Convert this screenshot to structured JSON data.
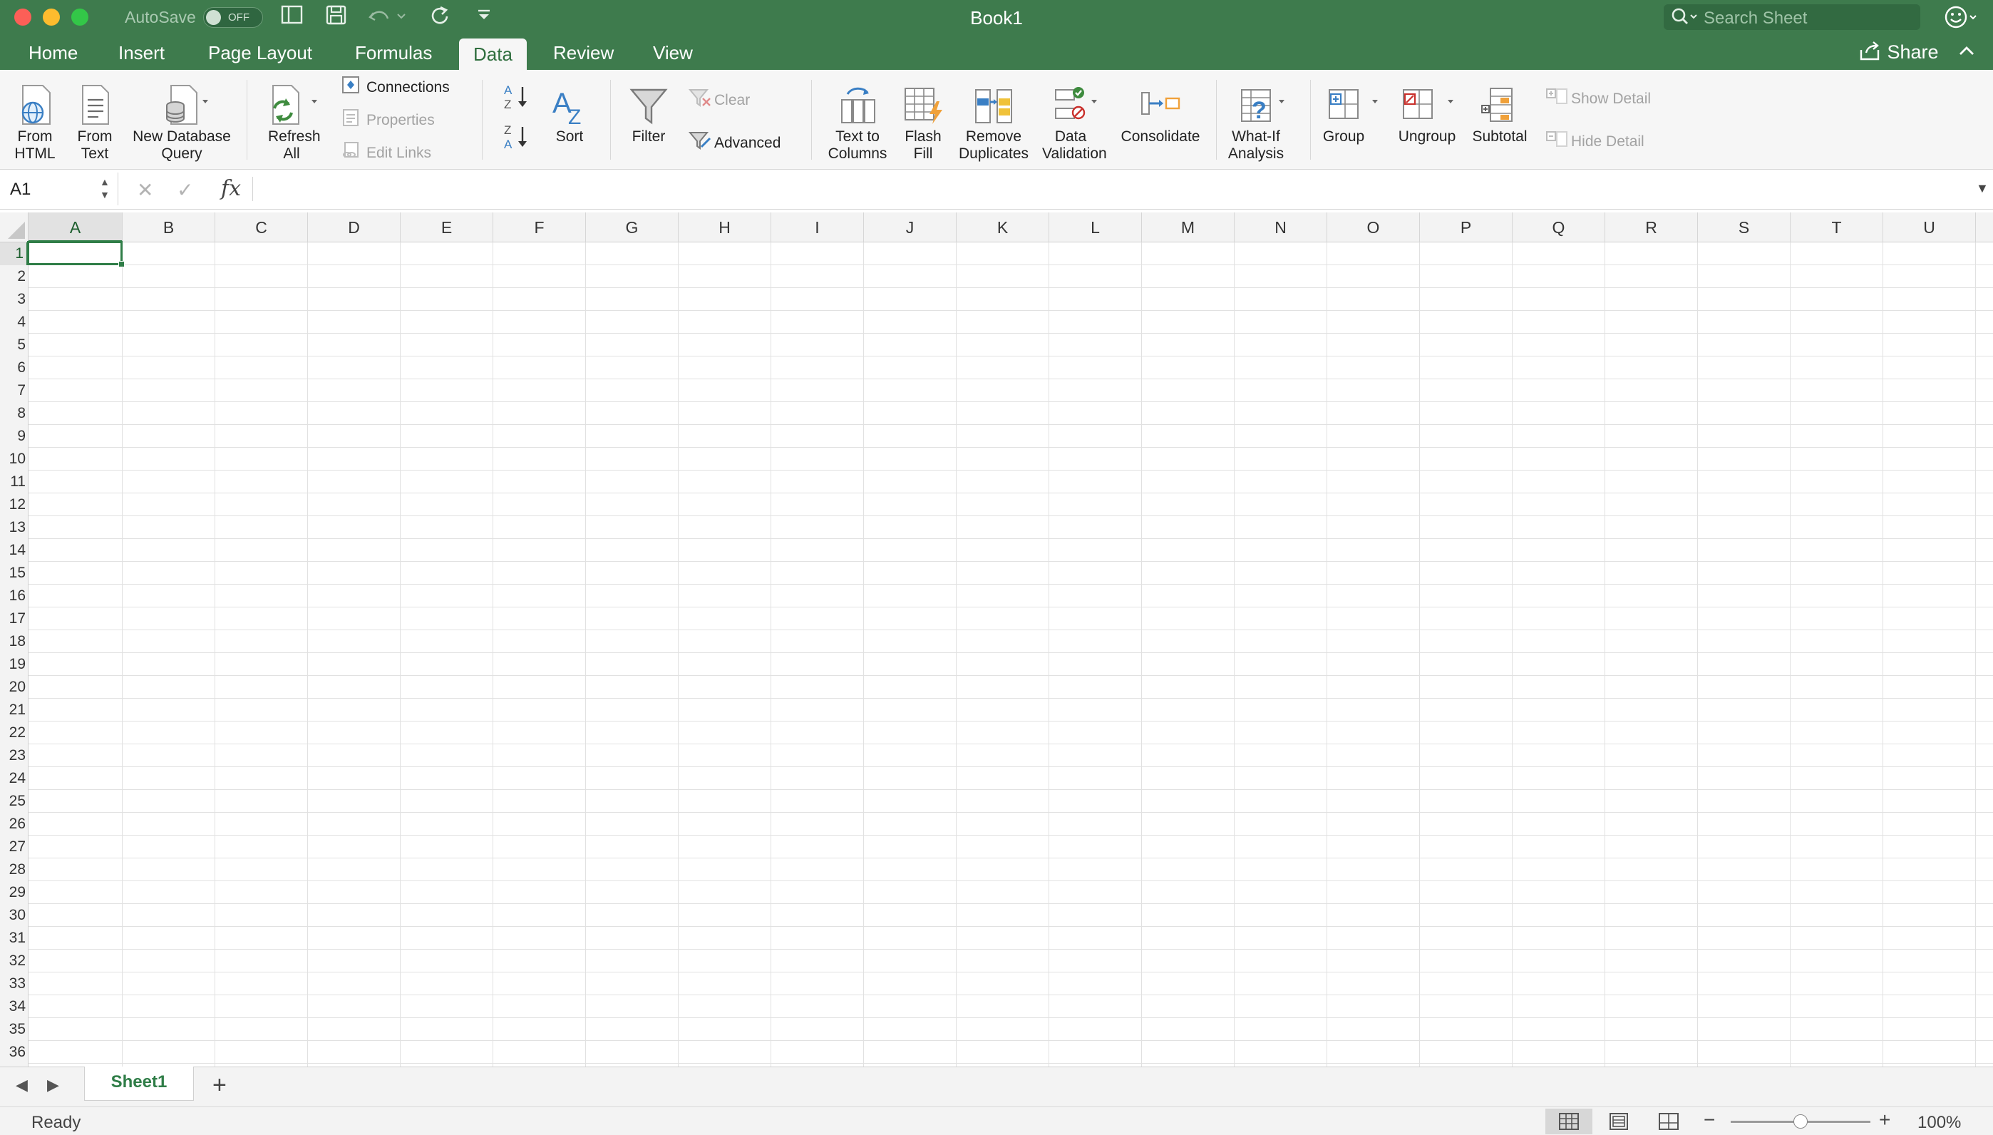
{
  "window": {
    "title": "Book1",
    "autosave_label": "AutoSave",
    "autosave_state": "OFF",
    "search_placeholder": "Search Sheet"
  },
  "tabs": [
    {
      "label": "Home"
    },
    {
      "label": "Insert"
    },
    {
      "label": "Page Layout"
    },
    {
      "label": "Formulas"
    },
    {
      "label": "Data",
      "active": true
    },
    {
      "label": "Review"
    },
    {
      "label": "View"
    }
  ],
  "share_label": "Share",
  "ribbon": {
    "from_html": "From HTML",
    "from_text": "From Text",
    "new_db_query": "New Database Query",
    "refresh_all": "Refresh All",
    "connections": "Connections",
    "properties": "Properties",
    "edit_links": "Edit Links",
    "sort": "Sort",
    "filter": "Filter",
    "clear": "Clear",
    "advanced": "Advanced",
    "text_to_columns": "Text to Columns",
    "flash_fill": "Flash Fill",
    "remove_duplicates": "Remove Duplicates",
    "data_validation": "Data Validation",
    "consolidate": "Consolidate",
    "what_if": "What-If Analysis",
    "group": "Group",
    "ungroup": "Ungroup",
    "subtotal": "Subtotal",
    "show_detail": "Show Detail",
    "hide_detail": "Hide Detail"
  },
  "formula_bar": {
    "name_box": "A1",
    "fx_label": "fx",
    "formula": ""
  },
  "grid": {
    "columns": [
      "A",
      "B",
      "C",
      "D",
      "E",
      "F",
      "G",
      "H",
      "I",
      "J",
      "K",
      "L",
      "M",
      "N",
      "O",
      "P",
      "Q",
      "R",
      "S",
      "T",
      "U"
    ],
    "rows": [
      "1",
      "2",
      "3",
      "4",
      "5",
      "6",
      "7",
      "8",
      "9",
      "10",
      "11",
      "12",
      "13",
      "14",
      "15",
      "16",
      "17",
      "18",
      "19",
      "20",
      "21",
      "22",
      "23",
      "24",
      "25",
      "26",
      "27",
      "28",
      "29",
      "30",
      "31",
      "32",
      "33",
      "34",
      "35",
      "36"
    ],
    "active_cell": "A1"
  },
  "sheets": [
    {
      "label": "Sheet1",
      "active": true
    }
  ],
  "status": {
    "text": "Ready",
    "zoom": "100%",
    "zoom_fraction": 0.5
  },
  "colors": {
    "accent": "#3e7b4d",
    "selection": "#2f7d47"
  }
}
